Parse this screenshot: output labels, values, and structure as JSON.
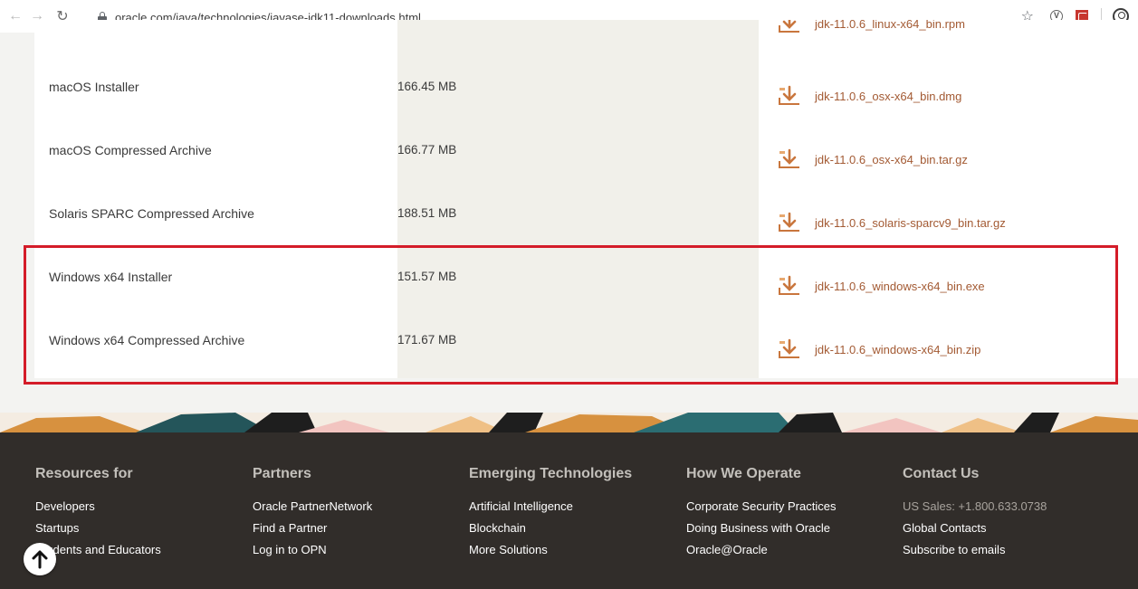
{
  "browser": {
    "url": "oracle.com/java/technologies/javase-jdk11-downloads.html",
    "icons": [
      "back-icon",
      "forward-icon",
      "reload-icon",
      "lock-icon",
      "star-icon",
      "vivaldi-extension-icon",
      "pdf-extension-icon",
      "profile-icon"
    ]
  },
  "downloads": {
    "partial_row": {
      "file": "jdk-11.0.6_linux-x64_bin.rpm"
    },
    "rows": [
      {
        "product": "macOS Installer",
        "size": "166.45 MB",
        "file": "jdk-11.0.6_osx-x64_bin.dmg"
      },
      {
        "product": "macOS Compressed Archive",
        "size": "166.77 MB",
        "file": "jdk-11.0.6_osx-x64_bin.tar.gz"
      },
      {
        "product": "Solaris SPARC Compressed Archive",
        "size": "188.51 MB",
        "file": "jdk-11.0.6_solaris-sparcv9_bin.tar.gz"
      },
      {
        "product": "Windows x64 Installer",
        "size": "151.57 MB",
        "file": "jdk-11.0.6_windows-x64_bin.exe"
      },
      {
        "product": "Windows x64 Compressed Archive",
        "size": "171.67 MB",
        "file": "jdk-11.0.6_windows-x64_bin.zip"
      }
    ],
    "highlight_color": "#d41c29",
    "link_color": "#a35a33"
  },
  "footer": {
    "columns": [
      {
        "heading": "Resources for",
        "links": [
          "Developers",
          "Startups",
          "Students and Educators"
        ]
      },
      {
        "heading": "Partners",
        "links": [
          "Oracle PartnerNetwork",
          "Find a Partner",
          "Log in to OPN"
        ]
      },
      {
        "heading": "Emerging Technologies",
        "links": [
          "Artificial Intelligence",
          "Blockchain",
          "More Solutions"
        ]
      },
      {
        "heading": "How We Operate",
        "links": [
          "Corporate Security Practices",
          "Doing Business with Oracle",
          "Oracle@Oracle"
        ]
      },
      {
        "heading": "Contact Us",
        "links": [
          "US Sales: +1.800.633.0738",
          "Global Contacts",
          "Subscribe to emails"
        ]
      }
    ],
    "background": "#312d2a",
    "scroll_top_icon": "arrow-up-icon"
  }
}
